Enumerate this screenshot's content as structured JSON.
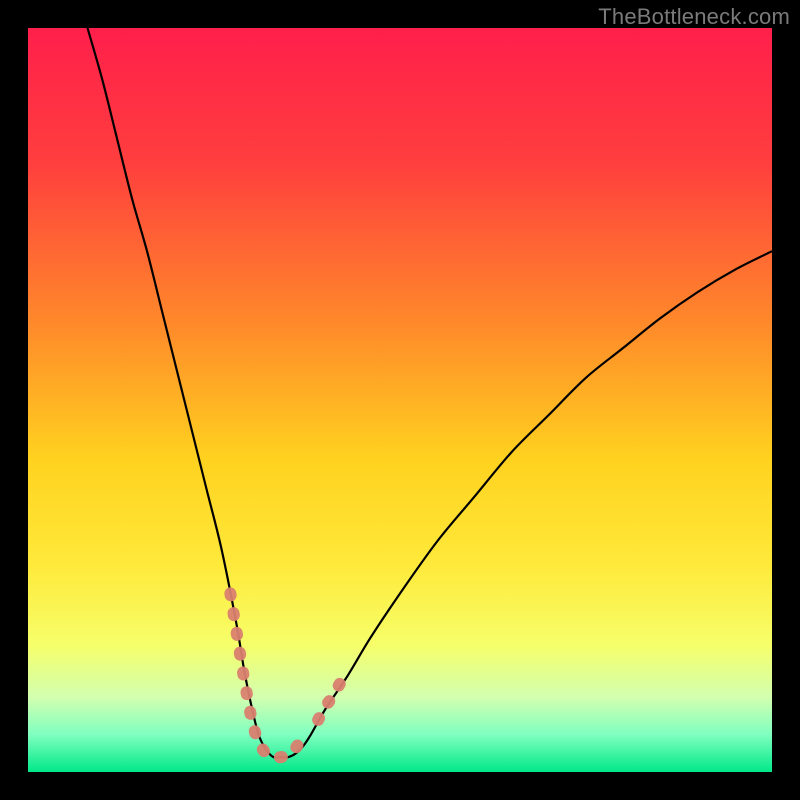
{
  "watermark": {
    "text": "TheBottleneck.com"
  },
  "colors": {
    "frame_bg": "#000000",
    "gradient_stops": [
      {
        "pct": 0,
        "color": "#ff1f4b"
      },
      {
        "pct": 18,
        "color": "#ff3e3e"
      },
      {
        "pct": 40,
        "color": "#ff8a2a"
      },
      {
        "pct": 58,
        "color": "#ffd21f"
      },
      {
        "pct": 72,
        "color": "#ffe93a"
      },
      {
        "pct": 83,
        "color": "#f6ff6a"
      },
      {
        "pct": 90,
        "color": "#d2ffb0"
      },
      {
        "pct": 95,
        "color": "#7fffc0"
      },
      {
        "pct": 100,
        "color": "#00e888"
      }
    ],
    "curve_stroke": "#000000",
    "highlight_stroke": "#d9806f"
  },
  "chart_data": {
    "type": "line",
    "title": "",
    "xlabel": "",
    "ylabel": "",
    "xlim": [
      0,
      100
    ],
    "ylim": [
      0,
      100
    ],
    "series": [
      {
        "name": "bottleneck-curve",
        "x": [
          8,
          10,
          12,
          14,
          16,
          18,
          20,
          22,
          24,
          26,
          28,
          29,
          30,
          31,
          32,
          33,
          34,
          35,
          36,
          37,
          38,
          40,
          43,
          46,
          50,
          55,
          60,
          65,
          70,
          75,
          80,
          85,
          90,
          95,
          100
        ],
        "y": [
          100,
          93,
          85,
          77,
          70,
          62,
          54,
          46,
          38,
          30,
          20,
          14,
          9,
          5,
          3,
          2,
          2,
          2,
          2.5,
          3.5,
          5,
          8.5,
          13,
          18,
          24,
          31,
          37,
          43,
          48,
          53,
          57,
          61,
          64.5,
          67.5,
          70
        ]
      }
    ],
    "highlight_segments": [
      {
        "name": "left-valley",
        "x": [
          27.2,
          28.0,
          28.8,
          29.5,
          30.2,
          31.0,
          32.0,
          33.0,
          34.0,
          35.0,
          35.8,
          36.5
        ],
        "y": [
          24.0,
          19.0,
          14.0,
          10.0,
          6.5,
          4.0,
          2.5,
          2.0,
          2.0,
          2.3,
          3.0,
          4.0
        ]
      },
      {
        "name": "right-valley",
        "x": [
          39.0,
          39.8,
          40.8,
          42.0,
          43.0
        ],
        "y": [
          7.0,
          8.5,
          10.0,
          12.0,
          13.5
        ]
      }
    ]
  }
}
